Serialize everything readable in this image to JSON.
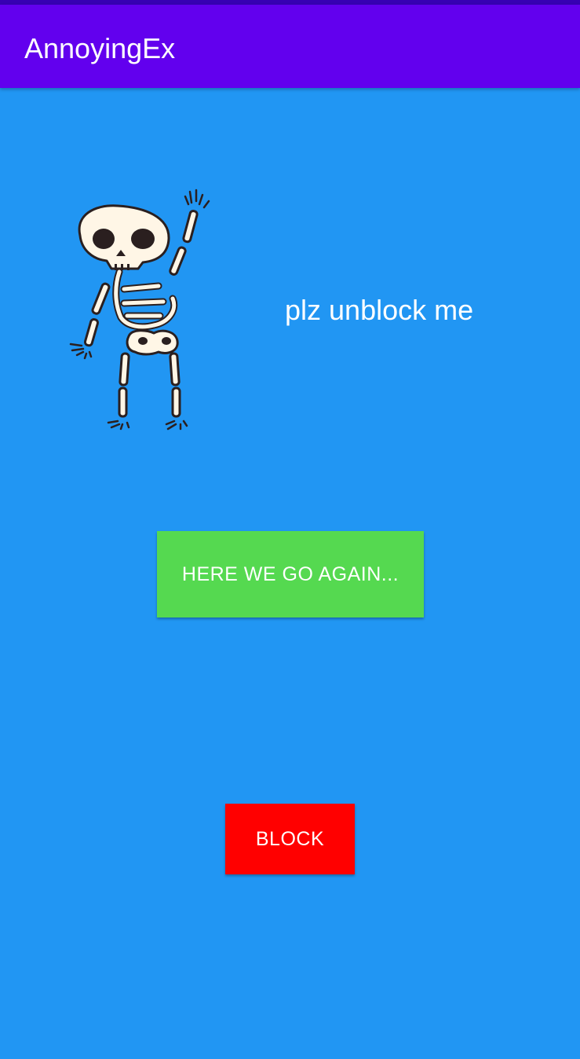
{
  "status_bar": {
    "color": "#3700B3"
  },
  "app_bar": {
    "title": "AnnoyingEx",
    "color": "#6200EE"
  },
  "main": {
    "background": "#2196F3",
    "image": {
      "icon": "waving-skeleton-image"
    },
    "message": "plz unblock me"
  },
  "buttons": {
    "again_label": "HERE WE GO AGAIN...",
    "again_color": "#55D950",
    "block_label": "BLOCK",
    "block_color": "#FF0000"
  }
}
